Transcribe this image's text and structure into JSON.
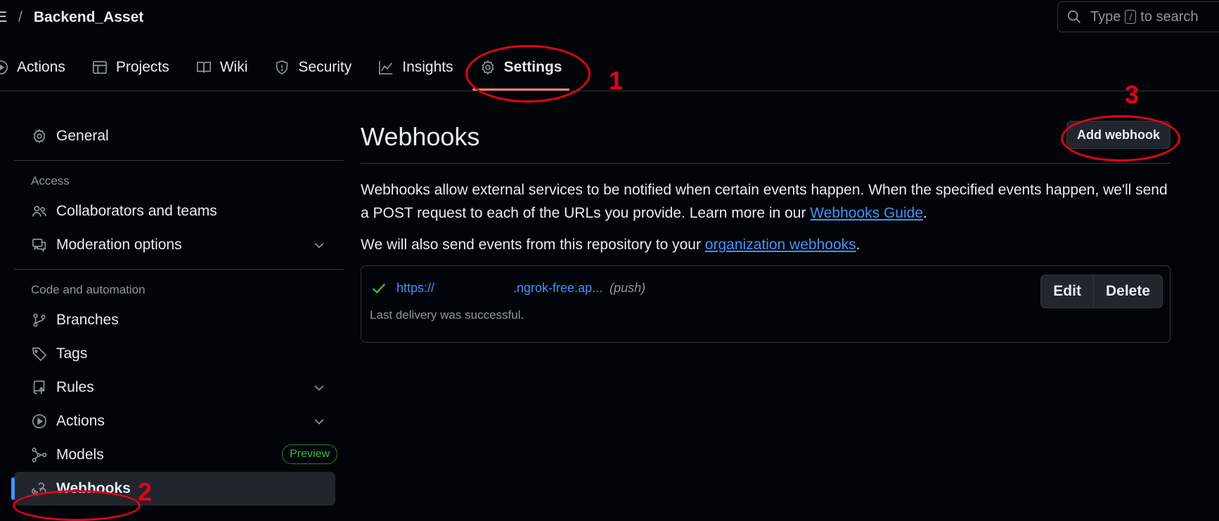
{
  "breadcrumb": {
    "owner": "E",
    "separator": "/",
    "repo": "Backend_Asset"
  },
  "search": {
    "prefix": "Type",
    "key": "/",
    "suffix": "to search"
  },
  "tabs": [
    {
      "label": "Actions",
      "icon": "play-icon"
    },
    {
      "label": "Projects",
      "icon": "table-icon"
    },
    {
      "label": "Wiki",
      "icon": "book-icon"
    },
    {
      "label": "Security",
      "icon": "shield-icon"
    },
    {
      "label": "Insights",
      "icon": "graph-icon"
    },
    {
      "label": "Settings",
      "icon": "gear-icon",
      "active": true
    }
  ],
  "annotations": {
    "one": "1",
    "two": "2",
    "three": "3"
  },
  "sidebar": {
    "general": "General",
    "access_heading": "Access",
    "collaborators": "Collaborators and teams",
    "moderation": "Moderation options",
    "code_heading": "Code and automation",
    "branches": "Branches",
    "tags": "Tags",
    "rules": "Rules",
    "actions": "Actions",
    "models": "Models",
    "models_badge": "Preview",
    "webhooks": "Webhooks"
  },
  "main": {
    "title": "Webhooks",
    "add_button": "Add webhook",
    "desc_text": "Webhooks allow external services to be notified when certain events happen. When the specified events happen, we'll send a POST request to each of the URLs you provide. Learn more in our ",
    "desc_link": "Webhooks Guide",
    "desc_end": ".",
    "org_text": "We will also send events from this repository to your ",
    "org_link": "organization webhooks",
    "org_end": "."
  },
  "webhook": {
    "url_start": "https://",
    "url_end": ".ngrok-free.ap...",
    "event": "(push)",
    "status": "Last delivery was successful.",
    "edit_label": "Edit",
    "delete_label": "Delete"
  },
  "colors": {
    "accent": "#4493f8",
    "annotation": "#e5001a",
    "success": "#3fb950",
    "tab_underline": "#f78166"
  }
}
